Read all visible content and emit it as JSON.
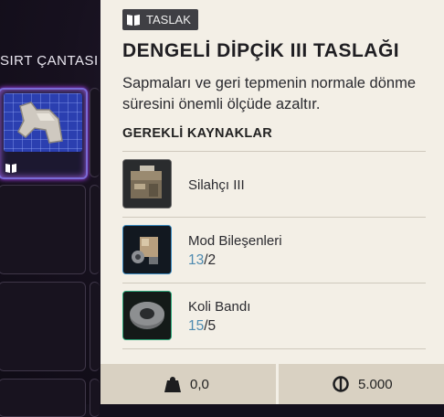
{
  "backpack": {
    "title": "SIRT ÇANTASI"
  },
  "tooltip": {
    "tag": "TASLAK",
    "title": "DENGELİ DİPÇİK III TASLAĞI",
    "description": "Sapmaları ve geri tepmenin normale dönme süresini önemli ölçüde azaltır.",
    "requirements_title": "GEREKLİ KAYNAKLAR",
    "requirements": [
      {
        "name": "Silahçı III",
        "icon": "workbench-icon"
      },
      {
        "name": "Mod Bileşenleri",
        "have": "13",
        "need": "/2",
        "icon": "mod-components-icon"
      },
      {
        "name": "Koli Bandı",
        "have": "15",
        "need": "/5",
        "icon": "duct-tape-icon"
      }
    ]
  },
  "footer": {
    "weight": "0,0",
    "price": "5.000"
  },
  "colors": {
    "tooltip_bg": "#f3efe6",
    "footer_bg": "#d9d1c2",
    "have_count": "#4f8bb0",
    "slot_selected": "#7a6bd6"
  }
}
